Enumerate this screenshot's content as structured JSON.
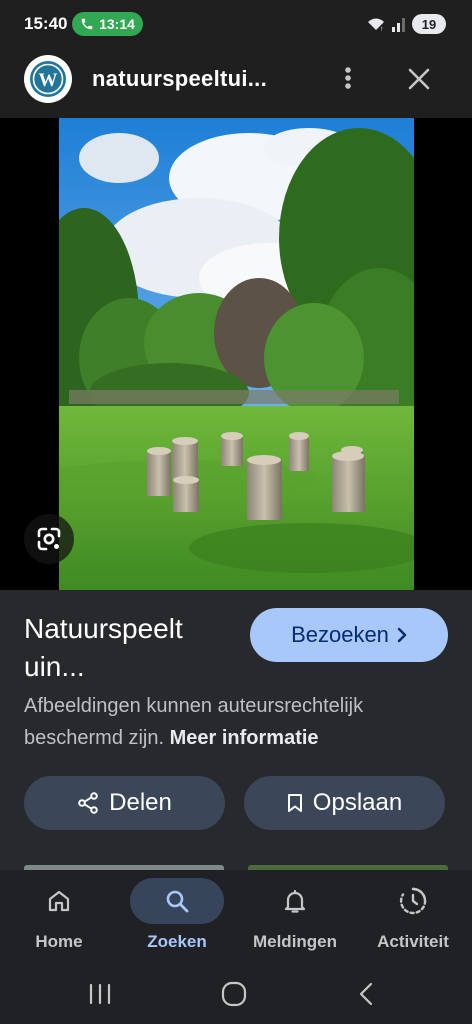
{
  "status_bar": {
    "time": "15:40",
    "call_duration": "13:14",
    "battery_level": "19",
    "icons": [
      "phone-icon",
      "wifi-icon",
      "signal-icon",
      "battery-icon"
    ]
  },
  "app_bar": {
    "site_name": "natuurspeeltui...",
    "site_icon": "wordpress-logo",
    "more_icon": "more-vert-icon",
    "close_icon": "close-icon"
  },
  "image": {
    "lens_icon": "google-lens-icon"
  },
  "result": {
    "title_line1": "Natuurspeelt",
    "title_line2": "uin...",
    "visit_label": "Bezoeken",
    "visit_icon": "chevron-right-icon",
    "copyright_text": "Afbeeldingen kunnen auteursrechtelijk beschermd zijn.",
    "more_info_link": "Meer informatie",
    "share_label": "Delen",
    "share_icon": "share-icon",
    "save_label": "Opslaan",
    "save_icon": "bookmark-icon"
  },
  "bottom_nav": {
    "items": [
      {
        "label": "Home",
        "icon": "home-icon",
        "active": false
      },
      {
        "label": "Zoeken",
        "icon": "search-icon",
        "active": true
      },
      {
        "label": "Meldingen",
        "icon": "bell-icon",
        "active": false
      },
      {
        "label": "Activiteit",
        "icon": "activity-icon",
        "active": false
      }
    ]
  },
  "system_nav": {
    "icons": [
      "recents-icon",
      "home-circle-icon",
      "back-icon"
    ]
  },
  "colors": {
    "accent": "#a8c7fa",
    "background": "#202124",
    "panel": "#28292c",
    "tonal_button": "#3b4758",
    "call_pill": "#32a852"
  }
}
